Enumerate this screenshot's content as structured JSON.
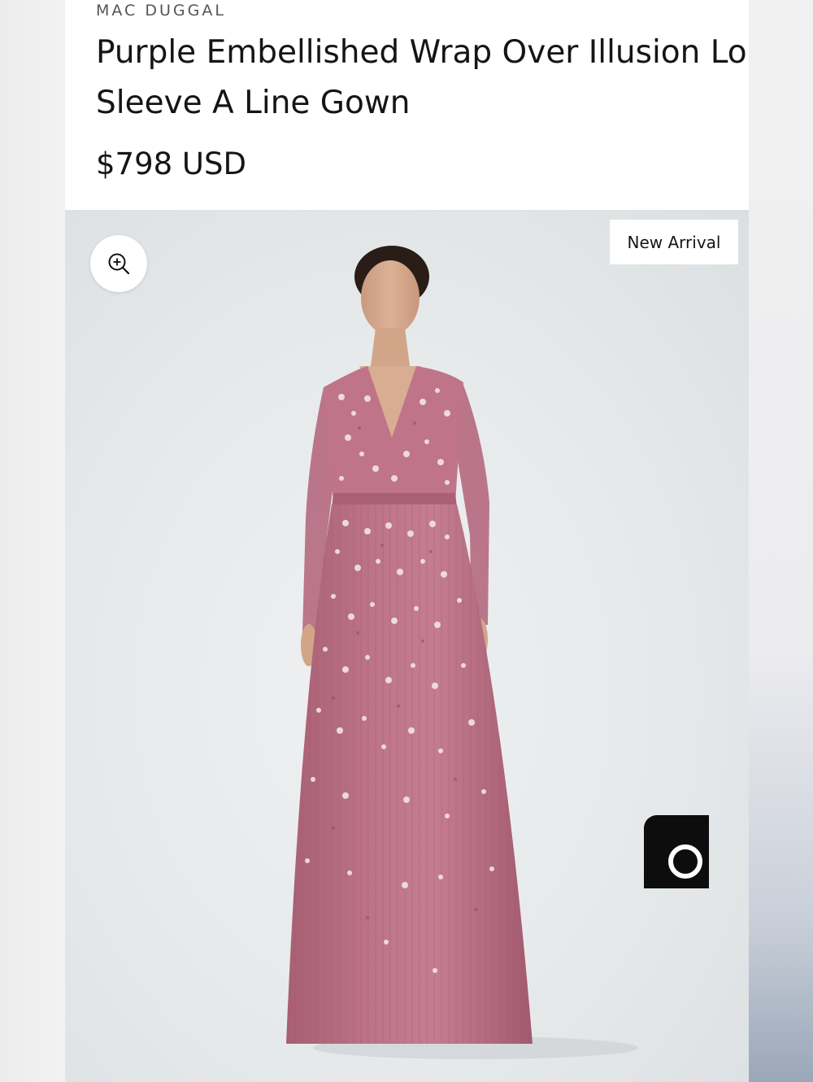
{
  "product": {
    "brand": "MAC DUGGAL",
    "title": "Purple Embellished Wrap Over Illusion Long Sleeve A Line Gown",
    "price": "$798 USD"
  },
  "gallery": {
    "badge": "New Arrival",
    "zoom_icon": "zoom-in-icon",
    "dress_color": "#b86f83",
    "background_color": "#e8eaeb"
  },
  "floating": {
    "accessibility_icon": "accessibility-icon",
    "accessibility_color": "#1e6be6",
    "chat_icon": "chat-icon",
    "chat_color": "#0d0d0d"
  }
}
